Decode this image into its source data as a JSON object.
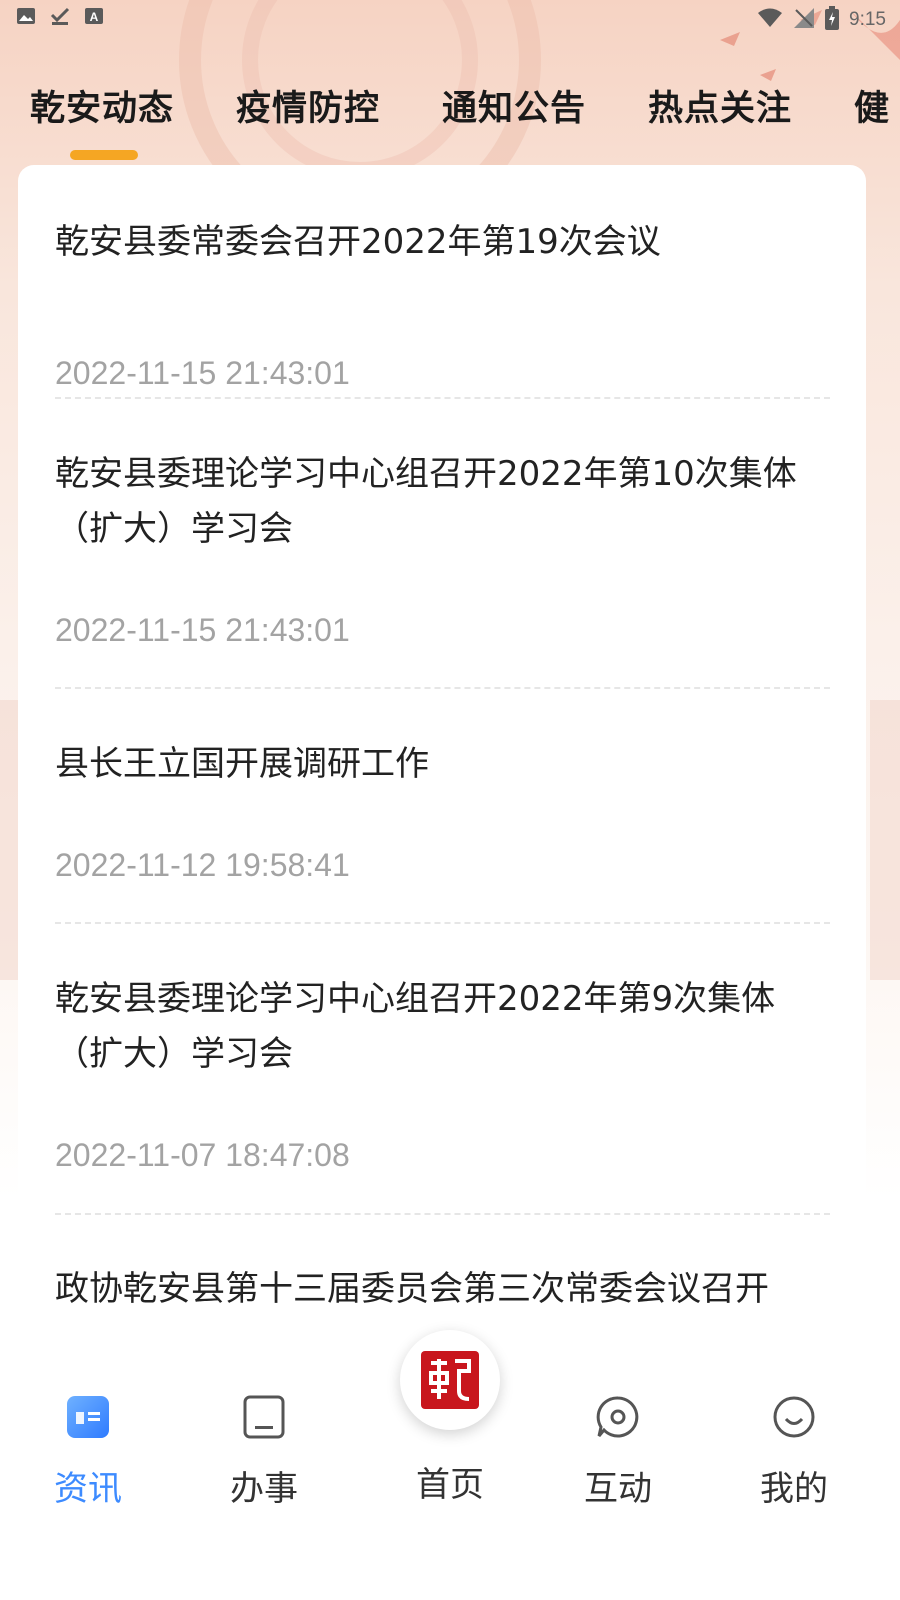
{
  "status_bar": {
    "time": "9:15",
    "left_icons": [
      "image-icon",
      "download-done-icon",
      "text-a-icon"
    ],
    "right_icons": [
      "wifi-icon",
      "no-signal-icon",
      "battery-charging-icon"
    ]
  },
  "tabs": [
    {
      "label": "乾安动态",
      "active": true
    },
    {
      "label": "疫情防控",
      "active": false
    },
    {
      "label": "通知公告",
      "active": false
    },
    {
      "label": "热点关注",
      "active": false
    },
    {
      "label": "健",
      "active": false
    }
  ],
  "news": [
    {
      "title": "乾安县委常委会召开2022年第19次会议",
      "time": "2022-11-15 21:43:01"
    },
    {
      "title": "乾安县委理论学习中心组召开2022年第10次集体（扩大）学习会",
      "time": "2022-11-15 21:43:01"
    },
    {
      "title": "县长王立国开展调研工作",
      "time": "2022-11-12 19:58:41"
    },
    {
      "title": "乾安县委理论学习中心组召开2022年第9次集体（扩大）学习会",
      "time": "2022-11-07 18:47:08"
    },
    {
      "title": "政协乾安县第十三届委员会第三次常委会议召开",
      "time": ""
    }
  ],
  "bottom_nav": [
    {
      "label": "资讯",
      "icon": "news-icon",
      "active": true
    },
    {
      "label": "办事",
      "icon": "tablet-icon",
      "active": false
    },
    {
      "label": "首页",
      "icon": "qian-seal-icon",
      "active": false
    },
    {
      "label": "互动",
      "icon": "chat-bubble-icon",
      "active": false
    },
    {
      "label": "我的",
      "icon": "smile-icon",
      "active": false
    }
  ],
  "colors": {
    "accent_blue": "#3d8bff",
    "indicator_orange": "#f5a623",
    "seal_red": "#c8161d"
  }
}
